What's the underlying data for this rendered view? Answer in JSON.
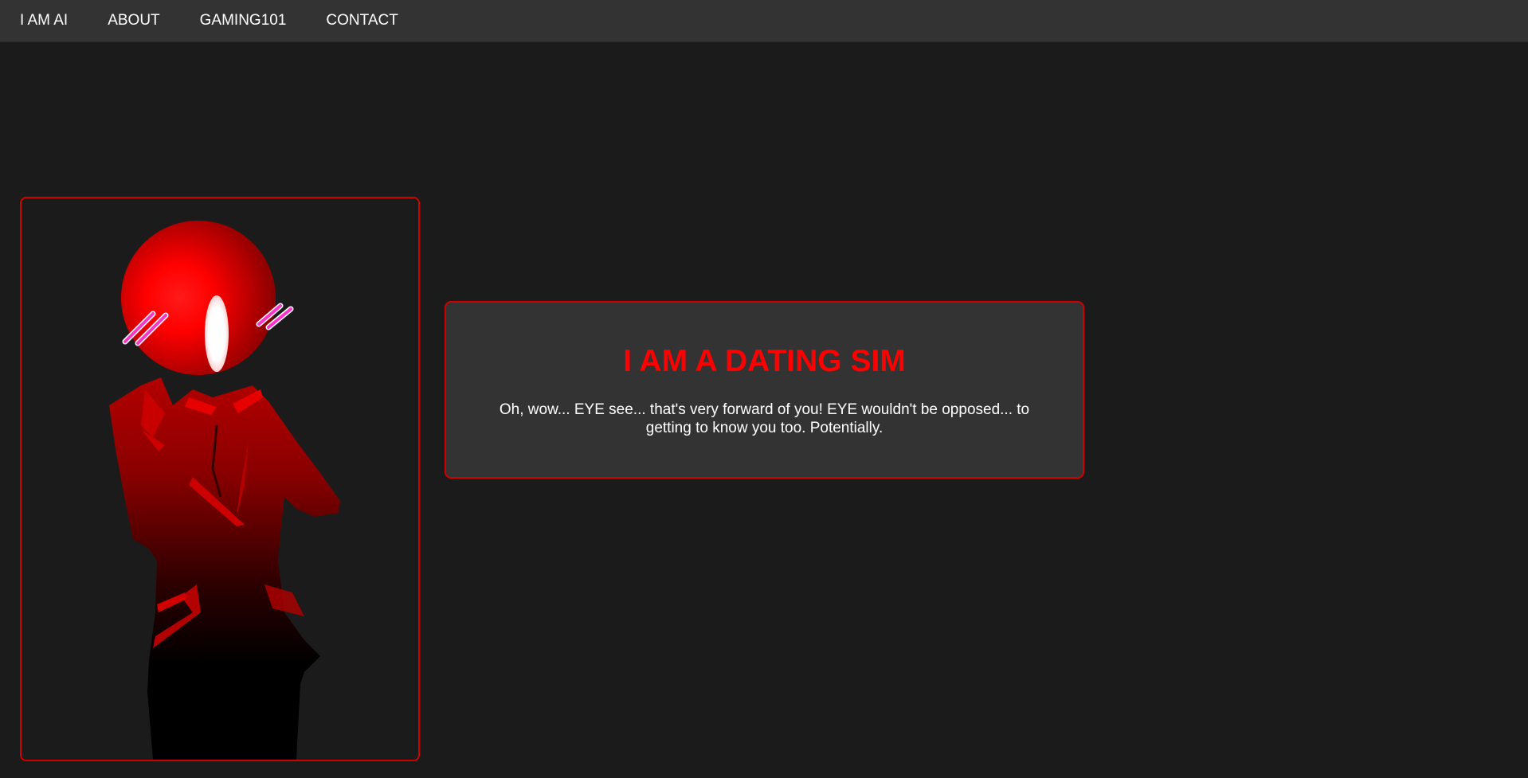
{
  "nav": {
    "items": [
      {
        "label": "I AM AI"
      },
      {
        "label": "ABOUT"
      },
      {
        "label": "GAMING101"
      },
      {
        "label": "CONTACT"
      }
    ]
  },
  "character": {
    "icon": "eye-headed-character-illustration",
    "mood": "blushing"
  },
  "dialog": {
    "title": "I AM A DATING SIM",
    "text": "Oh, wow... EYE see... that's very forward of you! EYE wouldn't be opposed... to getting to know you too. Potentially."
  },
  "colors": {
    "background": "#1b1b1b",
    "panel": "#333333",
    "accent": "#ff0000",
    "border": "#d00000",
    "blush": "#ff33cc"
  }
}
